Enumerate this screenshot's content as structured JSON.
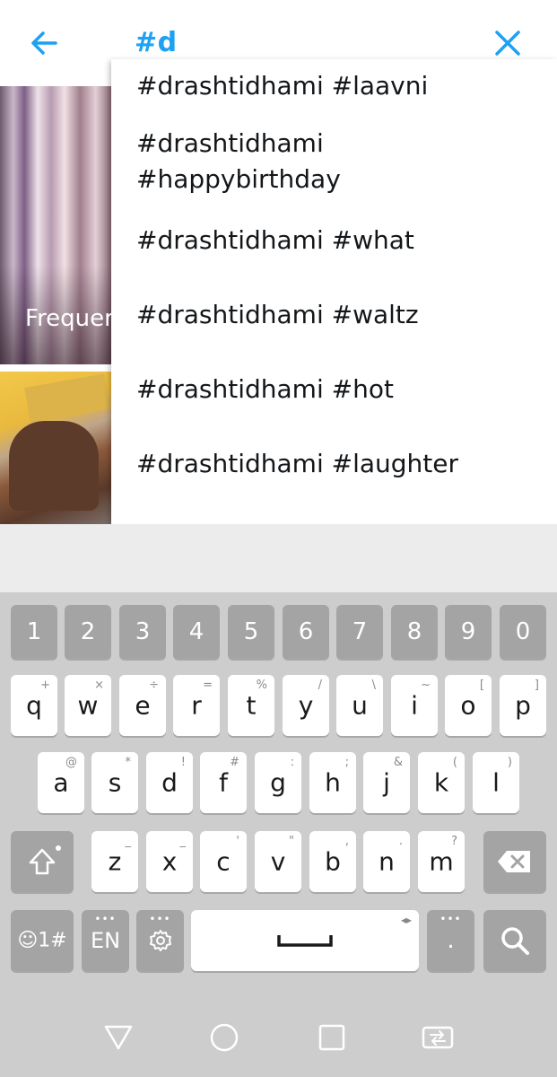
{
  "search": {
    "query": "#d"
  },
  "background": {
    "tile_label": "Frequen"
  },
  "suggestions": [
    {
      "line1": "#drashtidhami #laavni",
      "line2": ""
    },
    {
      "line1": "#drashtidhami",
      "line2": "#happybirthday"
    },
    {
      "line1": "#drashtidhami #what",
      "line2": ""
    },
    {
      "line1": "#drashtidhami #waltz",
      "line2": ""
    },
    {
      "line1": "#drashtidhami #hot",
      "line2": ""
    },
    {
      "line1": "#drashtidhami #laughter",
      "line2": ""
    }
  ],
  "keyboard": {
    "number_row": [
      "1",
      "2",
      "3",
      "4",
      "5",
      "6",
      "7",
      "8",
      "9",
      "0"
    ],
    "row1": [
      {
        "key": "q",
        "hint": "+"
      },
      {
        "key": "w",
        "hint": "×"
      },
      {
        "key": "e",
        "hint": "÷"
      },
      {
        "key": "r",
        "hint": "="
      },
      {
        "key": "t",
        "hint": "%"
      },
      {
        "key": "y",
        "hint": "/"
      },
      {
        "key": "u",
        "hint": "\\"
      },
      {
        "key": "i",
        "hint": "~"
      },
      {
        "key": "o",
        "hint": "["
      },
      {
        "key": "p",
        "hint": "]"
      }
    ],
    "row2": [
      {
        "key": "a",
        "hint": "@"
      },
      {
        "key": "s",
        "hint": "*"
      },
      {
        "key": "d",
        "hint": "!"
      },
      {
        "key": "f",
        "hint": "#"
      },
      {
        "key": "g",
        "hint": ":"
      },
      {
        "key": "h",
        "hint": ";"
      },
      {
        "key": "j",
        "hint": "&"
      },
      {
        "key": "k",
        "hint": "("
      },
      {
        "key": "l",
        "hint": ")"
      }
    ],
    "row3": [
      {
        "key": "z",
        "hint": "_"
      },
      {
        "key": "x",
        "hint": "_"
      },
      {
        "key": "c",
        "hint": "'"
      },
      {
        "key": "v",
        "hint": "\""
      },
      {
        "key": "b",
        "hint": ","
      },
      {
        "key": "n",
        "hint": "."
      },
      {
        "key": "m",
        "hint": "?"
      }
    ],
    "emoji_label": "☺1#",
    "lang_label": "EN",
    "period_label": ".",
    "dots": "•••"
  },
  "icons": {
    "back": "arrow-left-icon",
    "close": "close-icon",
    "shift": "shift-icon",
    "backspace": "backspace-icon",
    "settings": "gear-icon",
    "search": "search-icon",
    "nav_back": "triangle-back-icon",
    "nav_home": "circle-home-icon",
    "nav_recents": "square-recents-icon",
    "nav_switch": "switch-apps-icon"
  },
  "colors": {
    "accent": "#1da1f2",
    "keyboard_bg": "#cdcdcd",
    "fn_key": "#a4a4a4"
  }
}
